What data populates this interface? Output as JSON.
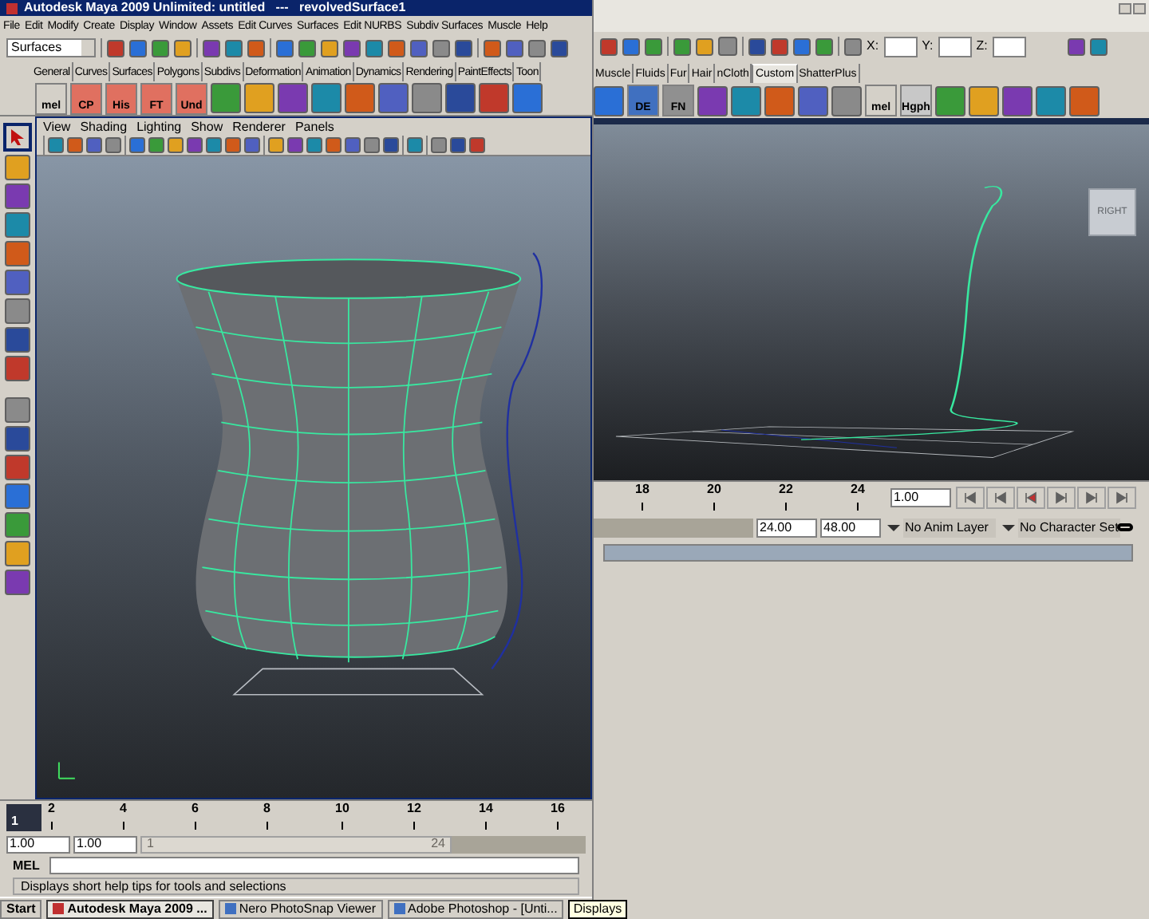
{
  "left_window": {
    "title": "Autodesk Maya 2009 Unlimited: untitled   ---   revolvedSurface1",
    "menu": [
      "File",
      "Edit",
      "Modify",
      "Create",
      "Display",
      "Window",
      "Assets",
      "Edit Curves",
      "Surfaces",
      "Edit NURBS",
      "Subdiv Surfaces",
      "Muscle",
      "Help"
    ],
    "menu_set": "Surfaces",
    "shelf_tabs": [
      {
        "label": "General",
        "selected": false
      },
      {
        "label": "Curves",
        "selected": false
      },
      {
        "label": "Surfaces",
        "selected": false
      },
      {
        "label": "Polygons",
        "selected": false
      },
      {
        "label": "Subdivs",
        "selected": false
      },
      {
        "label": "Deformation",
        "selected": false
      },
      {
        "label": "Animation",
        "selected": false
      },
      {
        "label": "Dynamics",
        "selected": false
      },
      {
        "label": "Rendering",
        "selected": false
      },
      {
        "label": "PaintEffects",
        "selected": false
      },
      {
        "label": "Toon",
        "selected": false
      }
    ],
    "shelf_labels": [
      "mel",
      "CP",
      "His",
      "FT",
      "Und"
    ],
    "panel_menu": [
      "View",
      "Shading",
      "Lighting",
      "Show",
      "Renderer",
      "Panels"
    ],
    "current_frame": "1",
    "time_ticks": [
      "2",
      "4",
      "6",
      "8",
      "10",
      "12",
      "14",
      "16"
    ],
    "range_fields": [
      "1.00",
      "1.00"
    ],
    "range_slider": {
      "start": "1",
      "end": "24"
    },
    "command_label": "MEL",
    "help_line": "Displays short help tips for tools and selections"
  },
  "right_window": {
    "xyz_labels": [
      "X:",
      "Y:",
      "Z:"
    ],
    "shelf_tabs": [
      {
        "label": "Muscle",
        "selected": false
      },
      {
        "label": "Fluids",
        "selected": false
      },
      {
        "label": "Fur",
        "selected": false
      },
      {
        "label": "Hair",
        "selected": false
      },
      {
        "label": "nCloth",
        "selected": false
      },
      {
        "label": "Custom",
        "selected": true
      },
      {
        "label": "ShatterPlus",
        "selected": false
      }
    ],
    "shelf_labels": [
      "DE",
      "FN",
      "mel",
      "Hgph"
    ],
    "view_cube": "RIGHT",
    "time_ticks": [
      "18",
      "20",
      "22",
      "24"
    ],
    "current_time": "1.00",
    "range_fields": [
      "24.00",
      "48.00"
    ],
    "anim_layer": "No Anim Layer",
    "character_set": "No Character Set"
  },
  "taskbar": {
    "start": "Start",
    "items": [
      {
        "label": "Autodesk Maya 2009 ...",
        "selected": true
      },
      {
        "label": "Nero PhotoSnap Viewer",
        "selected": false
      },
      {
        "label": "Adobe Photoshop - [Unti...",
        "selected": false
      }
    ],
    "tooltip": "Displays"
  }
}
